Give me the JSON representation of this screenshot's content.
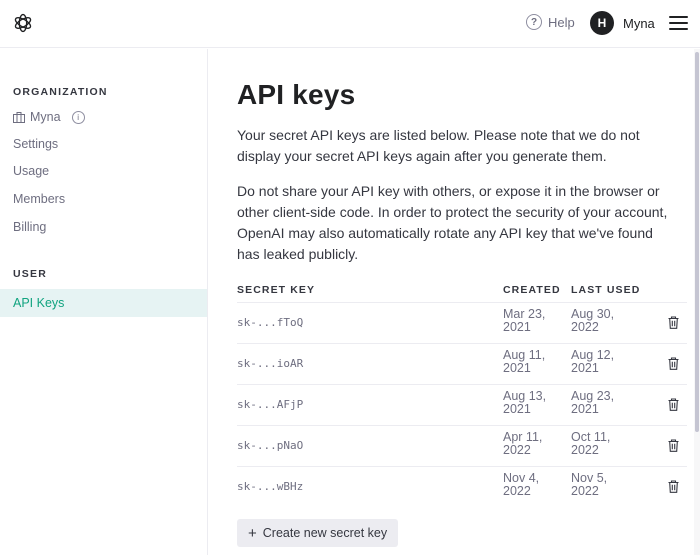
{
  "topbar": {
    "help_label": "Help",
    "user_initial": "H",
    "user_name": "Myna"
  },
  "sidebar": {
    "organization_heading": "ORGANIZATION",
    "org_name": "Myna",
    "items": [
      {
        "label": "Settings"
      },
      {
        "label": "Usage"
      },
      {
        "label": "Members"
      },
      {
        "label": "Billing"
      }
    ],
    "user_heading": "USER",
    "active_item": "API Keys"
  },
  "main": {
    "title": "API keys",
    "paragraph_1": "Your secret API keys are listed below. Please note that we do not display your secret API keys again after you generate them.",
    "paragraph_2": "Do not share your API key with others, or expose it in the browser or other client-side code. In order to protect the security of your account, OpenAI may also automatically rotate any API key that we've found has leaked publicly.",
    "table": {
      "columns": [
        "SECRET KEY",
        "CREATED",
        "LAST USED"
      ],
      "rows": [
        {
          "key": "sk-...fToQ",
          "created": "Mar 23, 2021",
          "last_used": "Aug 30, 2022"
        },
        {
          "key": "sk-...ioAR",
          "created": "Aug 11, 2021",
          "last_used": "Aug 12, 2021"
        },
        {
          "key": "sk-...AFjP",
          "created": "Aug 13, 2021",
          "last_used": "Aug 23, 2021"
        },
        {
          "key": "sk-...pNaO",
          "created": "Apr 11, 2022",
          "last_used": "Oct 11, 2022"
        },
        {
          "key": "sk-...wBHz",
          "created": "Nov 4, 2022",
          "last_used": "Nov 5, 2022"
        }
      ]
    },
    "create_button_label": "Create new secret key"
  },
  "colors": {
    "accent": "#10a37f",
    "active_bg": "#e6f3f3",
    "text": "#353740",
    "muted": "#6e6e80"
  },
  "icons": [
    "openai-logo-icon",
    "help-icon",
    "menu-icon",
    "organization-icon",
    "info-icon",
    "trash-icon",
    "plus-icon"
  ]
}
